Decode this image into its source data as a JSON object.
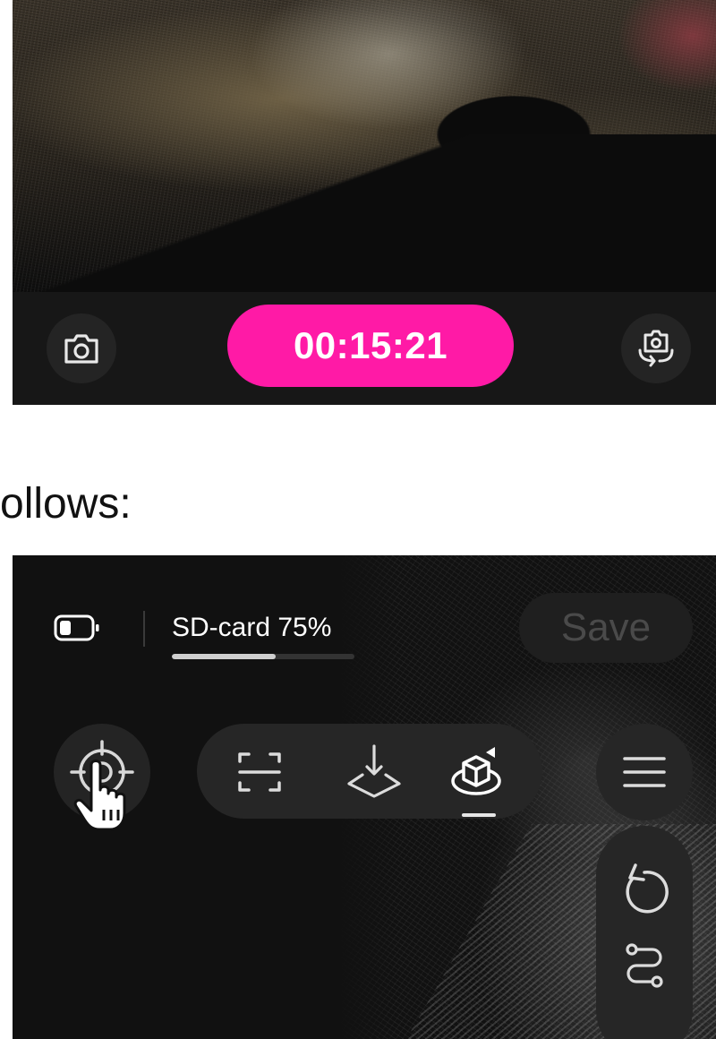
{
  "top_screen": {
    "timer": "00:15:21",
    "accent_color": "#ff1aa6",
    "left_button_icon": "camera-icon",
    "right_button_icon": "camera-switch-icon"
  },
  "caption": "ollows:",
  "bottom_screen": {
    "battery_icon": "battery-icon",
    "storage_label": "SD-card 75%",
    "storage_progress": 0.57,
    "save_label": "Save",
    "tools": [
      {
        "icon": "scan-frame-icon"
      },
      {
        "icon": "ground-point-icon"
      },
      {
        "icon": "3d-model-icon",
        "active": true
      }
    ],
    "locate_icon": "target-locate-icon",
    "menu_icon": "menu-icon",
    "side_icons": [
      "undo-icon",
      "route-icon"
    ],
    "cursor_icon": "hand-cursor-icon"
  }
}
